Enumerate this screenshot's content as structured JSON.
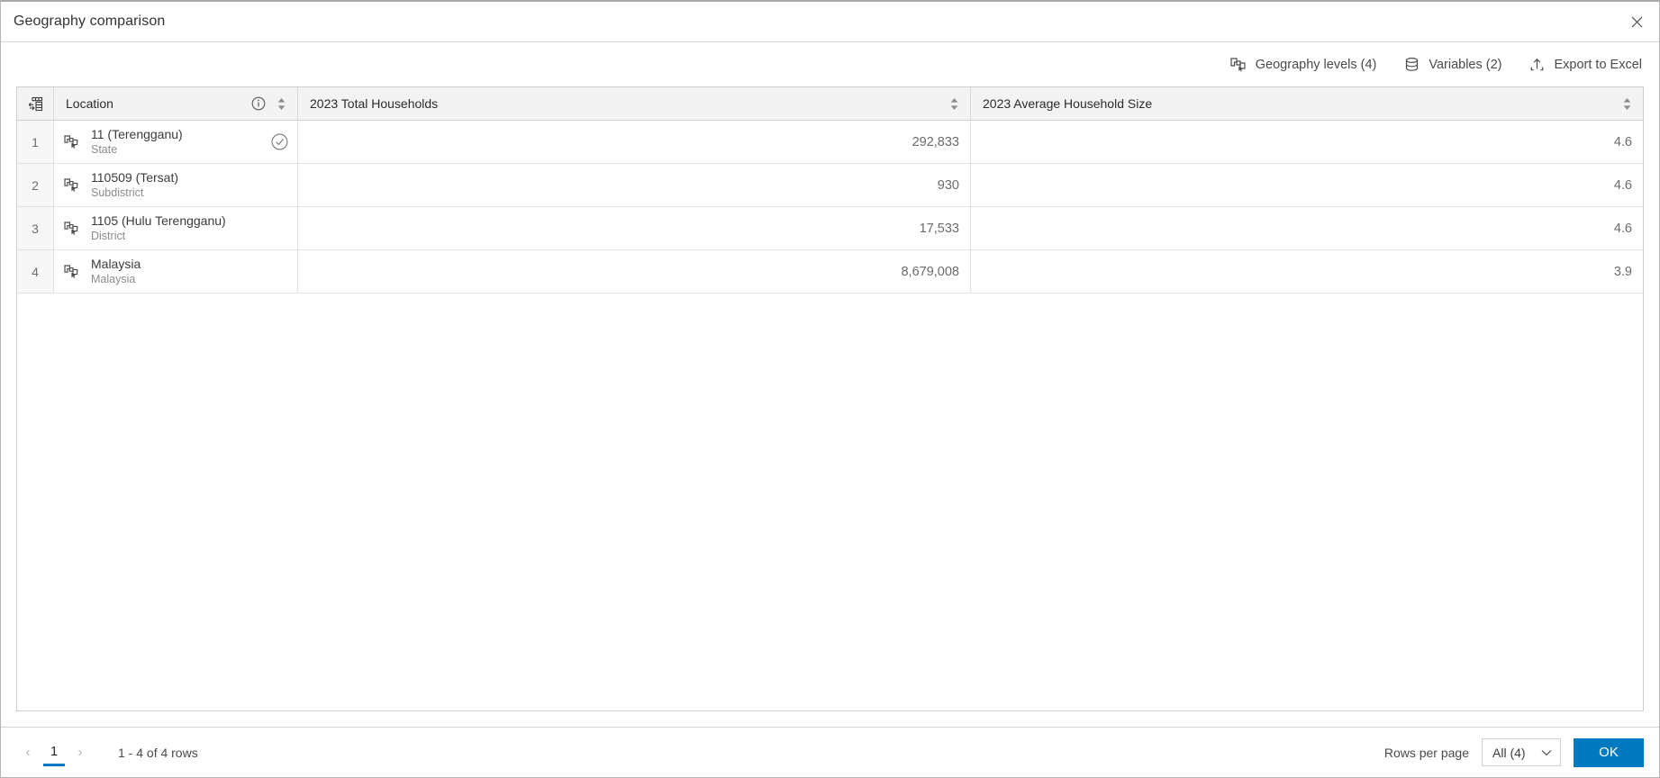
{
  "window": {
    "title": "Geography comparison",
    "close_icon": "close-icon"
  },
  "toolbar": {
    "buttons": [
      {
        "label": "Geography levels (4)",
        "icon": "geography-layers-icon"
      },
      {
        "label": "Variables (2)",
        "icon": "database-icon"
      },
      {
        "label": "Export to Excel",
        "icon": "export-upload-icon"
      }
    ]
  },
  "table": {
    "header_icon": "transpose-table-icon",
    "columns": [
      {
        "label": "Location",
        "info_icon": "info-icon",
        "sort_icon": "sort-icon"
      },
      {
        "label": "2023 Total Households",
        "sort_icon": "sort-icon"
      },
      {
        "label": "2023 Average Household Size",
        "sort_icon": "sort-icon"
      }
    ],
    "rows": [
      {
        "index": "1",
        "geo_icon": "geography-select-icon",
        "name": "11 (Terengganu)",
        "type": "State",
        "selected_icon": "check-circle-icon",
        "selected": true,
        "total_households": "292,833",
        "avg_household_size": "4.6"
      },
      {
        "index": "2",
        "geo_icon": "geography-select-icon",
        "name": "110509 (Tersat)",
        "type": "Subdistrict",
        "selected": false,
        "total_households": "930",
        "avg_household_size": "4.6"
      },
      {
        "index": "3",
        "geo_icon": "geography-select-icon",
        "name": "1105 (Hulu Terengganu)",
        "type": "District",
        "selected": false,
        "total_households": "17,533",
        "avg_household_size": "4.6"
      },
      {
        "index": "4",
        "geo_icon": "geography-select-icon",
        "name": "Malaysia",
        "type": "Malaysia",
        "selected": false,
        "total_households": "8,679,008",
        "avg_household_size": "3.9"
      }
    ]
  },
  "footer": {
    "prev_label": "‹",
    "page_number": "1",
    "next_label": "›",
    "row_count": "1 - 4 of 4 rows",
    "rows_per_page_label": "Rows per page",
    "rows_per_page_value": "All (4)",
    "ok_label": "OK"
  },
  "colors": {
    "accent": "#0079c1",
    "header_bg": "#f3f3f3",
    "border": "#cfcfcf",
    "text": "#323232",
    "muted_text": "#8c8c8c"
  }
}
